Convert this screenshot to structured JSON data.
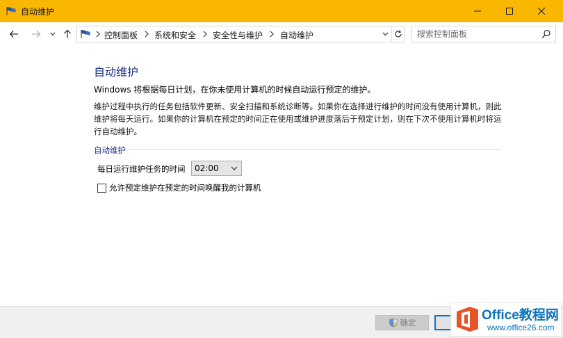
{
  "window": {
    "title": "自动维护",
    "accent": "#f9b700"
  },
  "navigation": {
    "breadcrumb": [
      "控制面板",
      "系统和安全",
      "安全性与维护",
      "自动维护"
    ],
    "search_placeholder": "搜索控制面板"
  },
  "main": {
    "title": "自动维护",
    "lead": "Windows 将根据每日计划，在你未使用计算机的时候自动运行预定的维护。",
    "description": "维护过程中执行的任务包括软件更新、安全扫描和系统诊断等。如果你在选择进行维护的时间没有使用计算机，则此维护将每天运行。如果你的计算机在预定的时间正在使用或维护进度落后于预定计划，则在下次不使用计算机时将运行自动维护。",
    "section_label": "自动维护",
    "time_label": "每日运行维护任务的时间",
    "time_value": "02:00",
    "wake_label": "允许预定维护在预定的时间唤醒我的计算机",
    "wake_checked": false
  },
  "footer": {
    "ok_label": "确定",
    "ok_enabled": false,
    "cancel_label": ""
  },
  "watermark": {
    "title": "Office教程网",
    "url": "www.office26.com"
  },
  "icons": {
    "window": "control-panel-flag-icon",
    "ok": "uac-shield-icon"
  }
}
